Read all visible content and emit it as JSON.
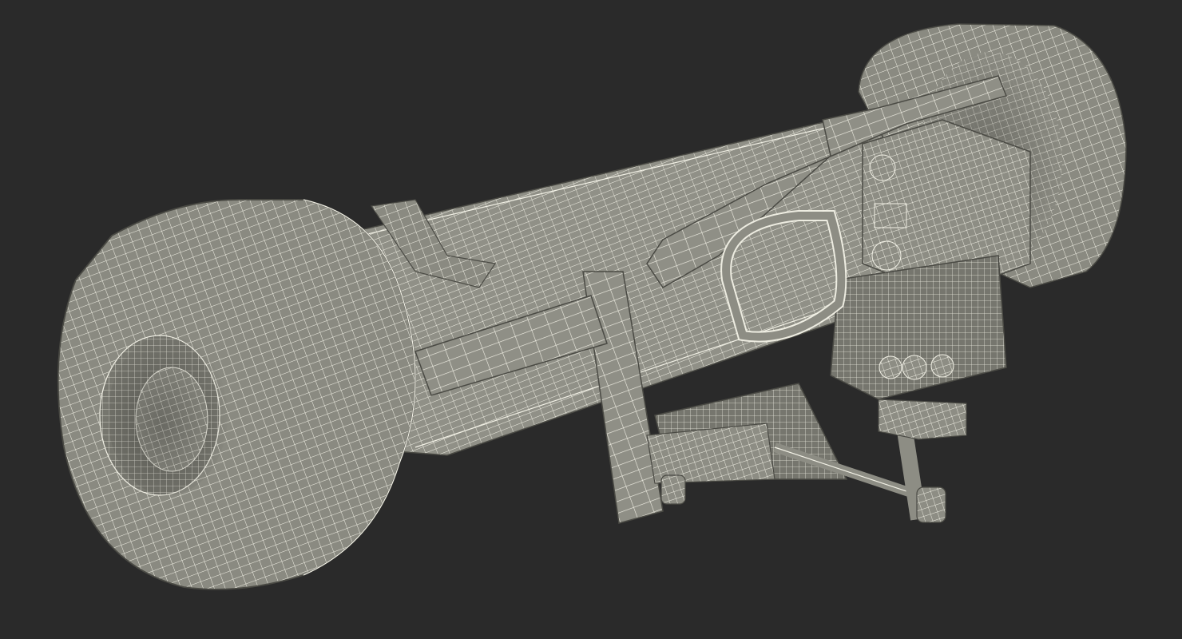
{
  "scene": {
    "subject": "wireframe-launcher-model",
    "colors": {
      "background": "#2a2a2a",
      "body_fill": "#8d8d84",
      "body_fill_dark": "#6e6e66",
      "body_fill_light": "#a4a49a",
      "wire": "#f2f1e6",
      "edge_shadow": "#4a4a44"
    }
  }
}
